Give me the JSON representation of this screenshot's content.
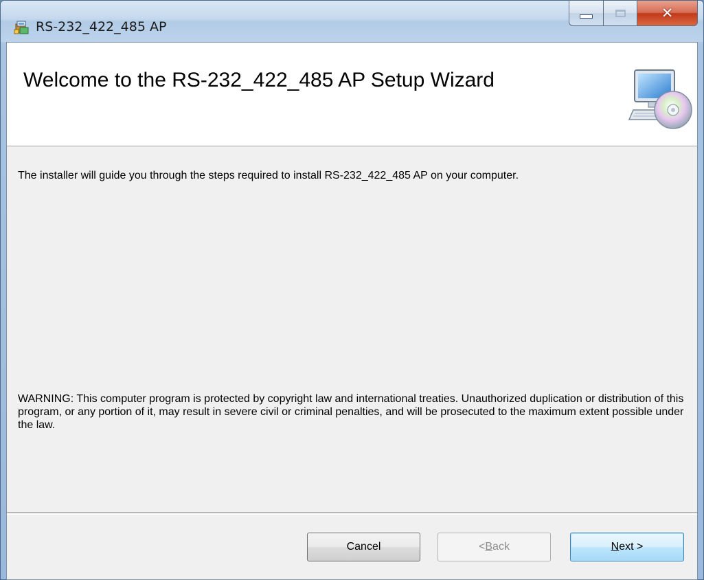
{
  "window": {
    "title": "RS-232_422_485 AP",
    "icon": "installer-package-icon",
    "controls": {
      "minimize": "minimize-icon",
      "maximize": "maximize-icon",
      "close": "close-icon"
    }
  },
  "banner": {
    "title": "Welcome to the RS-232_422_485 AP Setup Wizard",
    "icon": "computer-disc-icon"
  },
  "content": {
    "intro": "The installer will guide you through the steps required to install RS-232_422_485 AP on your computer.",
    "warning": "WARNING: This computer program is protected by copyright law and international treaties. Unauthorized duplication or distribution of this program, or any portion of it, may result in severe civil or criminal penalties, and will be prosecuted to the maximum extent possible under the law."
  },
  "buttons": {
    "cancel": "Cancel",
    "back_prefix": "< ",
    "back_mnemonic": "B",
    "back_rest": "ack",
    "next_mnemonic": "N",
    "next_rest": "ext >"
  },
  "colors": {
    "client_background": "#f0f0f0",
    "banner_background": "#ffffff",
    "close_button": "#c2391b"
  }
}
